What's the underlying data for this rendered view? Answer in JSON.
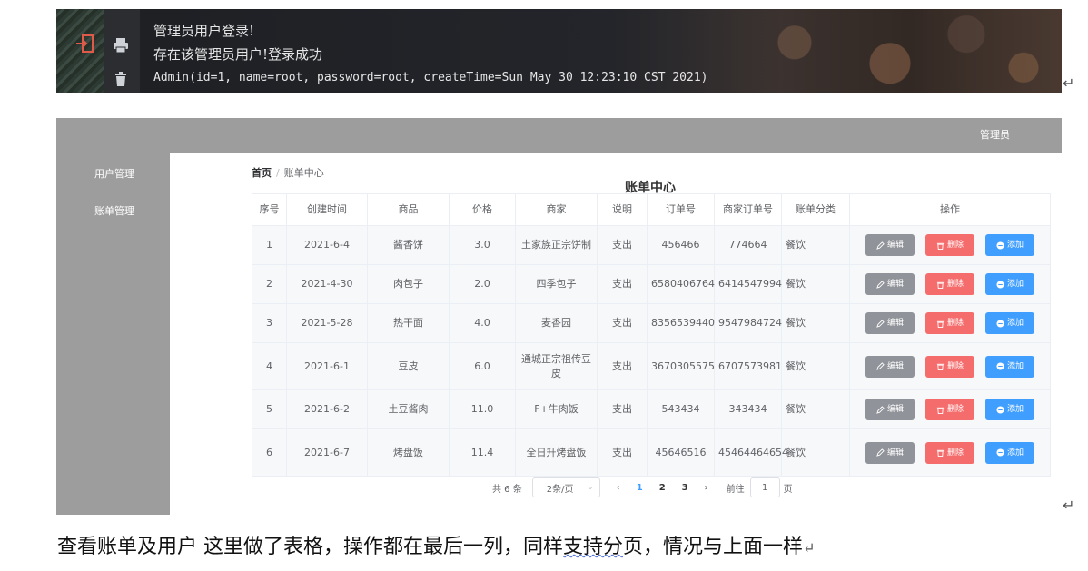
{
  "console": {
    "lines": [
      "管理员用户登录!",
      "存在该管理员用户!登录成功",
      "Admin(id=1, name=root, password=root, createTime=Sun May 30 12:23:10 CST 2021)"
    ]
  },
  "header": {
    "user": "管理员"
  },
  "sidebar": {
    "items": [
      {
        "label": "用户管理"
      },
      {
        "label": "账单管理"
      }
    ]
  },
  "breadcrumb": {
    "home": "首页",
    "separator": "/",
    "current": "账单中心"
  },
  "page_title": "账单中心",
  "table": {
    "columns": [
      "序号",
      "创建时间",
      "商品",
      "价格",
      "商家",
      "说明",
      "订单号",
      "商家订单号",
      "账单分类",
      "操作"
    ],
    "rows": [
      {
        "no": "1",
        "time": "2021-6-4",
        "goods": "酱香饼",
        "price": "3.0",
        "merchant": "土家族正宗饼制",
        "note": "支出",
        "order": "456466",
        "merchant_order": "774664",
        "category": "餐饮"
      },
      {
        "no": "2",
        "time": "2021-4-30",
        "goods": "肉包子",
        "price": "2.0",
        "merchant": "四季包子",
        "note": "支出",
        "order": "6580406764",
        "merchant_order": "6414547994",
        "category": "餐饮"
      },
      {
        "no": "3",
        "time": "2021-5-28",
        "goods": "热干面",
        "price": "4.0",
        "merchant": "麦香园",
        "note": "支出",
        "order": "8356539440",
        "merchant_order": "9547984724",
        "category": "餐饮"
      },
      {
        "no": "4",
        "time": "2021-6-1",
        "goods": "豆皮",
        "price": "6.0",
        "merchant": "通城正宗祖传豆皮",
        "note": "支出",
        "order": "3670305575",
        "merchant_order": "6707573981",
        "category": "餐饮"
      },
      {
        "no": "5",
        "time": "2021-6-2",
        "goods": "土豆酱肉",
        "price": "11.0",
        "merchant": "F+牛肉饭",
        "note": "支出",
        "order": "543434",
        "merchant_order": "343434",
        "category": "餐饮"
      },
      {
        "no": "6",
        "time": "2021-6-7",
        "goods": "烤盘饭",
        "price": "11.4",
        "merchant": "全日升烤盘饭",
        "note": "支出",
        "order": "45646516",
        "merchant_order": "45464464654",
        "category": "餐饮"
      }
    ],
    "actions": {
      "edit": "编辑",
      "delete": "删除",
      "add": "添加"
    }
  },
  "pagination": {
    "total": "共 6 条",
    "page_size": "2条/页",
    "prev": "‹",
    "pages": [
      "1",
      "2",
      "3"
    ],
    "current_page": "1",
    "next": "›",
    "goto_prefix": "前往",
    "goto_value": "1",
    "goto_suffix": "页"
  },
  "caption": {
    "part1": "查看账单及用户  这里做了表格，操作都在最后一列，同样",
    "underlined": "支持分",
    "part2": "页，情况与上面一样"
  },
  "return_mark": "↵",
  "colors": {
    "edit": "#909399",
    "delete": "#f56c6c",
    "add": "#409eff",
    "sidebar": "#9d9d9d",
    "active_page": "#409eff"
  },
  "icons": [
    "exit-icon",
    "print-icon",
    "trash-icon",
    "edit-icon",
    "delete-icon",
    "add-icon",
    "chevron-down-icon"
  ]
}
